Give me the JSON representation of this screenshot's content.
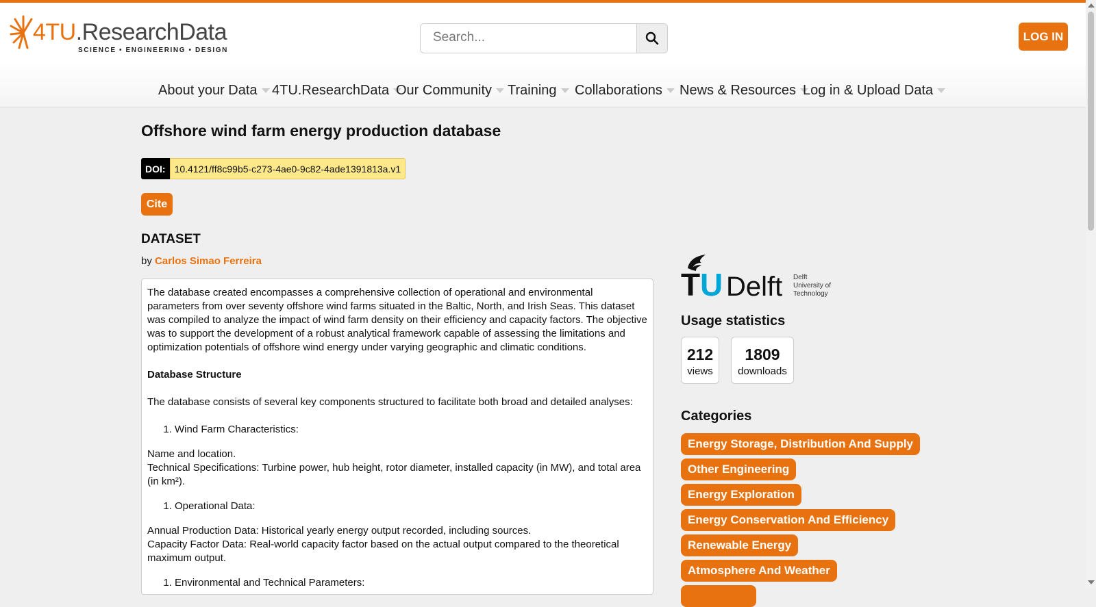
{
  "header": {
    "logo_main": "4TU",
    "logo_secondary": ".ResearchData",
    "logo_sub": "SCIENCE • ENGINEERING • DESIGN",
    "search_placeholder": "Search...",
    "login_label": "LOG IN",
    "accent_color": "#e8720f"
  },
  "nav": {
    "items": [
      {
        "label": "About your Data"
      },
      {
        "label": "4TU.ResearchData"
      },
      {
        "label": "Our Community"
      },
      {
        "label": "Training"
      },
      {
        "label": "Collaborations"
      },
      {
        "label": "News & Resources"
      },
      {
        "label": "Log in & Upload Data"
      }
    ]
  },
  "dataset": {
    "title": "Offshore wind farm energy production database",
    "doi_label": "DOI:",
    "doi_value": "10.4121/ff8c99b5-c273-4ae0-9c82-4ade1391813a.v1",
    "cite_label": "Cite",
    "type_label": "DATASET",
    "by_prefix": "by",
    "author": "Carlos Simao Ferreira",
    "description": {
      "intro": "The database created encompasses a comprehensive collection of operational and environmental parameters from over seventy offshore wind farms situated in the Baltic, North, and Irish Seas. This dataset was compiled to analyze the impact of wind farm density on their efficiency and capacity factors. The objective was to support the development of a robust analytical framework capable of assessing the limitations and optimization potentials of offshore wind energy under varying geographic and climatic conditions.",
      "structure_heading": "Database Structure",
      "structure_intro": "The database consists of several key components structured to facilitate both broad and detailed analyses:",
      "item1": "Wind Farm Characteristics:",
      "item1_line1": "Name and location.",
      "item1_line2": "Technical Specifications: Turbine power, hub height, rotor diameter, installed capacity (in MW), and total area (in km²).",
      "item2": "Operational Data:",
      "item2_line1": "Annual Production Data: Historical yearly energy output recorded, including sources.",
      "item2_line2": "Capacity Factor Data: Real-world capacity factor based on the actual output compared to the theoretical maximum output.",
      "item3": "Environmental and Technical Parameters:"
    }
  },
  "sidebar": {
    "institution_logo_text": "TUDelft",
    "institution_logo_sub1": "Delft",
    "institution_logo_sub2": "University of",
    "institution_logo_sub3": "Technology",
    "stats_title": "Usage statistics",
    "views_count": "212",
    "views_label": "views",
    "downloads_count": "1809",
    "downloads_label": "downloads",
    "categories_title": "Categories",
    "categories": [
      "Energy Storage, Distribution And Supply",
      "Other Engineering",
      "Energy Exploration",
      "Energy Conservation And Efficiency",
      "Renewable Energy",
      "Atmosphere And Weather"
    ]
  }
}
